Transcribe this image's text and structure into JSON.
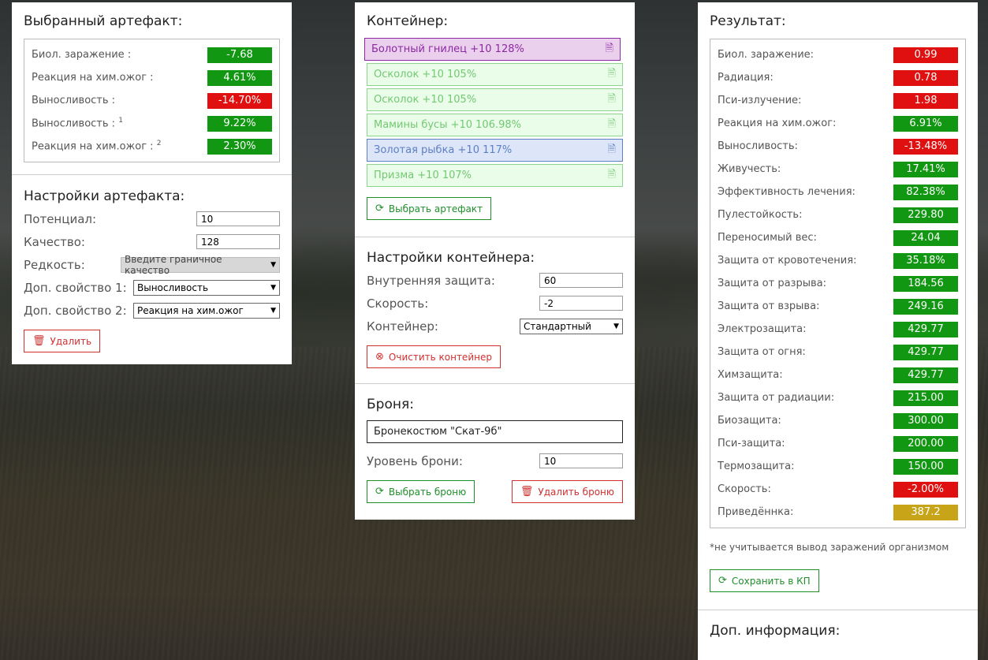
{
  "selected_artifact": {
    "title": "Выбранный артефакт:",
    "stats": [
      {
        "label": "Биол. заражение :",
        "sup": "",
        "value": "-7.68",
        "color": "green"
      },
      {
        "label": "Реакция на хим.ожог :",
        "sup": "",
        "value": "4.61%",
        "color": "green"
      },
      {
        "label": "Выносливость :",
        "sup": "",
        "value": "-14.70%",
        "color": "red"
      },
      {
        "label": "Выносливость :",
        "sup": "1",
        "value": "9.22%",
        "color": "green"
      },
      {
        "label": "Реакция на хим.ожог :",
        "sup": "2",
        "value": "2.30%",
        "color": "green"
      }
    ]
  },
  "artifact_settings": {
    "title": "Настройки артефакта:",
    "potential_label": "Потенциал:",
    "potential_value": "10",
    "quality_label": "Качество:",
    "quality_value": "128",
    "rarity_label": "Редкость:",
    "rarity_value": "Введите граничное качество",
    "extra1_label": "Доп. свойство 1:",
    "extra1_value": "Выносливость",
    "extra2_label": "Доп. свойство 2:",
    "extra2_value": "Реакция на хим.ожог",
    "delete_label": "Удалить"
  },
  "container": {
    "title": "Контейнер:",
    "artifacts": [
      {
        "label": "Болотный гнилец +10 128%",
        "style": "purple"
      },
      {
        "label": "Осколок +10 105%",
        "style": "green"
      },
      {
        "label": "Осколок +10 105%",
        "style": "green"
      },
      {
        "label": "Мамины бусы +10 106.98%",
        "style": "green"
      },
      {
        "label": "Золотая рыбка +10 117%",
        "style": "blue"
      },
      {
        "label": "Призма +10 107%",
        "style": "green"
      }
    ],
    "select_label": "Выбрать артефакт"
  },
  "container_settings": {
    "title": "Настройки контейнера:",
    "inner_label": "Внутренняя защита:",
    "inner_value": "60",
    "speed_label": "Скорость:",
    "speed_value": "-2",
    "type_label": "Контейнер:",
    "type_value": "Стандартный",
    "clear_label": "Очистить контейнер"
  },
  "armor": {
    "title": "Броня:",
    "name": "Бронекостюм \"Скат-9б\"",
    "level_label": "Уровень брони:",
    "level_value": "10",
    "select_label": "Выбрать броню",
    "delete_label": "Удалить броню"
  },
  "result": {
    "title": "Результат:",
    "stats": [
      {
        "label": "Биол. заражение:",
        "value": "0.99",
        "color": "red"
      },
      {
        "label": "Радиация:",
        "value": "0.78",
        "color": "red"
      },
      {
        "label": "Пси-излучение:",
        "value": "1.98",
        "color": "red"
      },
      {
        "label": "Реакция на хим.ожог:",
        "value": "6.91%",
        "color": "green"
      },
      {
        "label": "Выносливость:",
        "value": "-13.48%",
        "color": "red"
      },
      {
        "label": "Живучесть:",
        "value": "17.41%",
        "color": "green"
      },
      {
        "label": "Эффективность лечения:",
        "value": "82.38%",
        "color": "green"
      },
      {
        "label": "Пулестойкость:",
        "value": "229.80",
        "color": "green"
      },
      {
        "label": "Переносимый вес:",
        "value": "24.04",
        "color": "green"
      },
      {
        "label": "Защита от кровотечения:",
        "value": "35.18%",
        "color": "green"
      },
      {
        "label": "Защита от разрыва:",
        "value": "184.56",
        "color": "green"
      },
      {
        "label": "Защита от взрыва:",
        "value": "249.16",
        "color": "green"
      },
      {
        "label": "Электрозащита:",
        "value": "429.77",
        "color": "green"
      },
      {
        "label": "Защита от огня:",
        "value": "429.77",
        "color": "green"
      },
      {
        "label": "Химзащита:",
        "value": "429.77",
        "color": "green"
      },
      {
        "label": "Защита от радиации:",
        "value": "215.00",
        "color": "green"
      },
      {
        "label": "Биозащита:",
        "value": "300.00",
        "color": "green"
      },
      {
        "label": "Пси-защита:",
        "value": "200.00",
        "color": "green"
      },
      {
        "label": "Термозащита:",
        "value": "150.00",
        "color": "green"
      },
      {
        "label": "Скорость:",
        "value": "-2.00%",
        "color": "red"
      },
      {
        "label": "Приведённка:",
        "value": "387.2",
        "color": "gold"
      }
    ],
    "note": "*не учитывается вывод заражений организмом",
    "save_label": "Сохранить в КП"
  },
  "extra_info": {
    "title": "Доп. информация:"
  },
  "colors": {
    "green": "#129712",
    "red": "#e01010",
    "gold": "#c8a418"
  }
}
